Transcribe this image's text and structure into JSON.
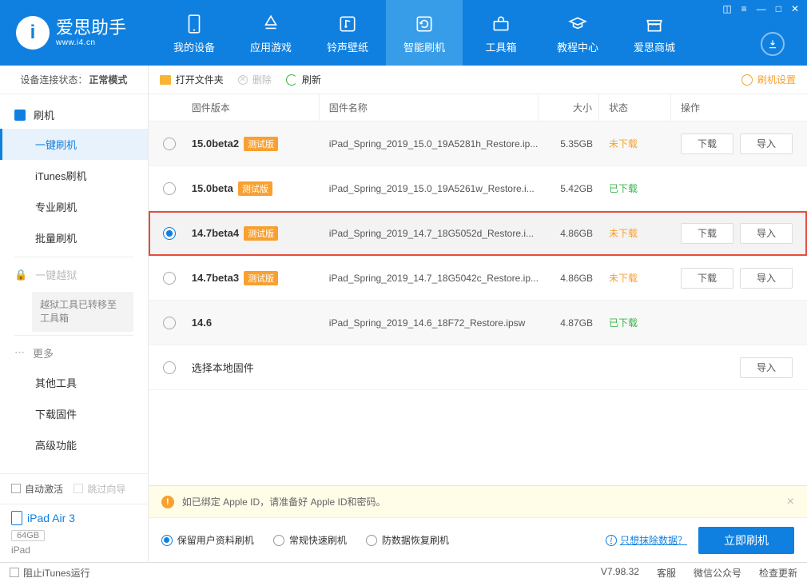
{
  "brand": {
    "name": "爱思助手",
    "url": "www.i4.cn"
  },
  "nav": {
    "items": [
      {
        "label": "我的设备"
      },
      {
        "label": "应用游戏"
      },
      {
        "label": "铃声壁纸"
      },
      {
        "label": "智能刷机"
      },
      {
        "label": "工具箱"
      },
      {
        "label": "教程中心"
      },
      {
        "label": "爱思商城"
      }
    ],
    "active_index": 3
  },
  "sidebar": {
    "connection_label": "设备连接状态：",
    "connection_value": "正常模式",
    "flash_group": "刷机",
    "flash_items": [
      "一键刷机",
      "iTunes刷机",
      "专业刷机",
      "批量刷机"
    ],
    "jailbreak_label": "一键越狱",
    "jailbreak_note": "越狱工具已转移至工具箱",
    "more_label": "更多",
    "more_items": [
      "其他工具",
      "下载固件",
      "高级功能"
    ],
    "auto_activate": "自动激活",
    "skip_guide": "跳过向导",
    "device_name": "iPad Air 3",
    "device_storage": "64GB",
    "device_type": "iPad",
    "block_itunes": "阻止iTunes运行"
  },
  "toolbar": {
    "open_folder": "打开文件夹",
    "delete": "删除",
    "refresh": "刷新",
    "settings": "刷机设置"
  },
  "table": {
    "headers": {
      "version": "固件版本",
      "name": "固件名称",
      "size": "大小",
      "status": "状态",
      "ops": "操作"
    },
    "btn_download": "下载",
    "btn_import": "导入",
    "local_firmware": "选择本地固件",
    "rows": [
      {
        "version": "15.0beta2",
        "beta": "测试版",
        "name": "iPad_Spring_2019_15.0_19A5281h_Restore.ip...",
        "size": "5.35GB",
        "status": "未下载",
        "status_cls": "st-und",
        "downloadable": true,
        "selected": false
      },
      {
        "version": "15.0beta",
        "beta": "测试版",
        "name": "iPad_Spring_2019_15.0_19A5261w_Restore.i...",
        "size": "5.42GB",
        "status": "已下载",
        "status_cls": "st-done",
        "downloadable": false,
        "selected": false
      },
      {
        "version": "14.7beta4",
        "beta": "测试版",
        "name": "iPad_Spring_2019_14.7_18G5052d_Restore.i...",
        "size": "4.86GB",
        "status": "未下载",
        "status_cls": "st-und",
        "downloadable": true,
        "selected": true,
        "highlight": true
      },
      {
        "version": "14.7beta3",
        "beta": "测试版",
        "name": "iPad_Spring_2019_14.7_18G5042c_Restore.ip...",
        "size": "4.86GB",
        "status": "未下载",
        "status_cls": "st-und",
        "downloadable": true,
        "selected": false
      },
      {
        "version": "14.6",
        "beta": "",
        "name": "iPad_Spring_2019_14.6_18F72_Restore.ipsw",
        "size": "4.87GB",
        "status": "已下载",
        "status_cls": "st-done",
        "downloadable": false,
        "selected": false
      }
    ]
  },
  "notice": "如已绑定 Apple ID，请准备好 Apple ID和密码。",
  "foot": {
    "options": [
      "保留用户资料刷机",
      "常规快速刷机",
      "防数据恢复刷机"
    ],
    "selected": 0,
    "erase_link": "只想抹除数据？",
    "flash_btn": "立即刷机"
  },
  "statusbar": {
    "version": "V7.98.32",
    "service": "客服",
    "wechat": "微信公众号",
    "update": "检查更新"
  }
}
